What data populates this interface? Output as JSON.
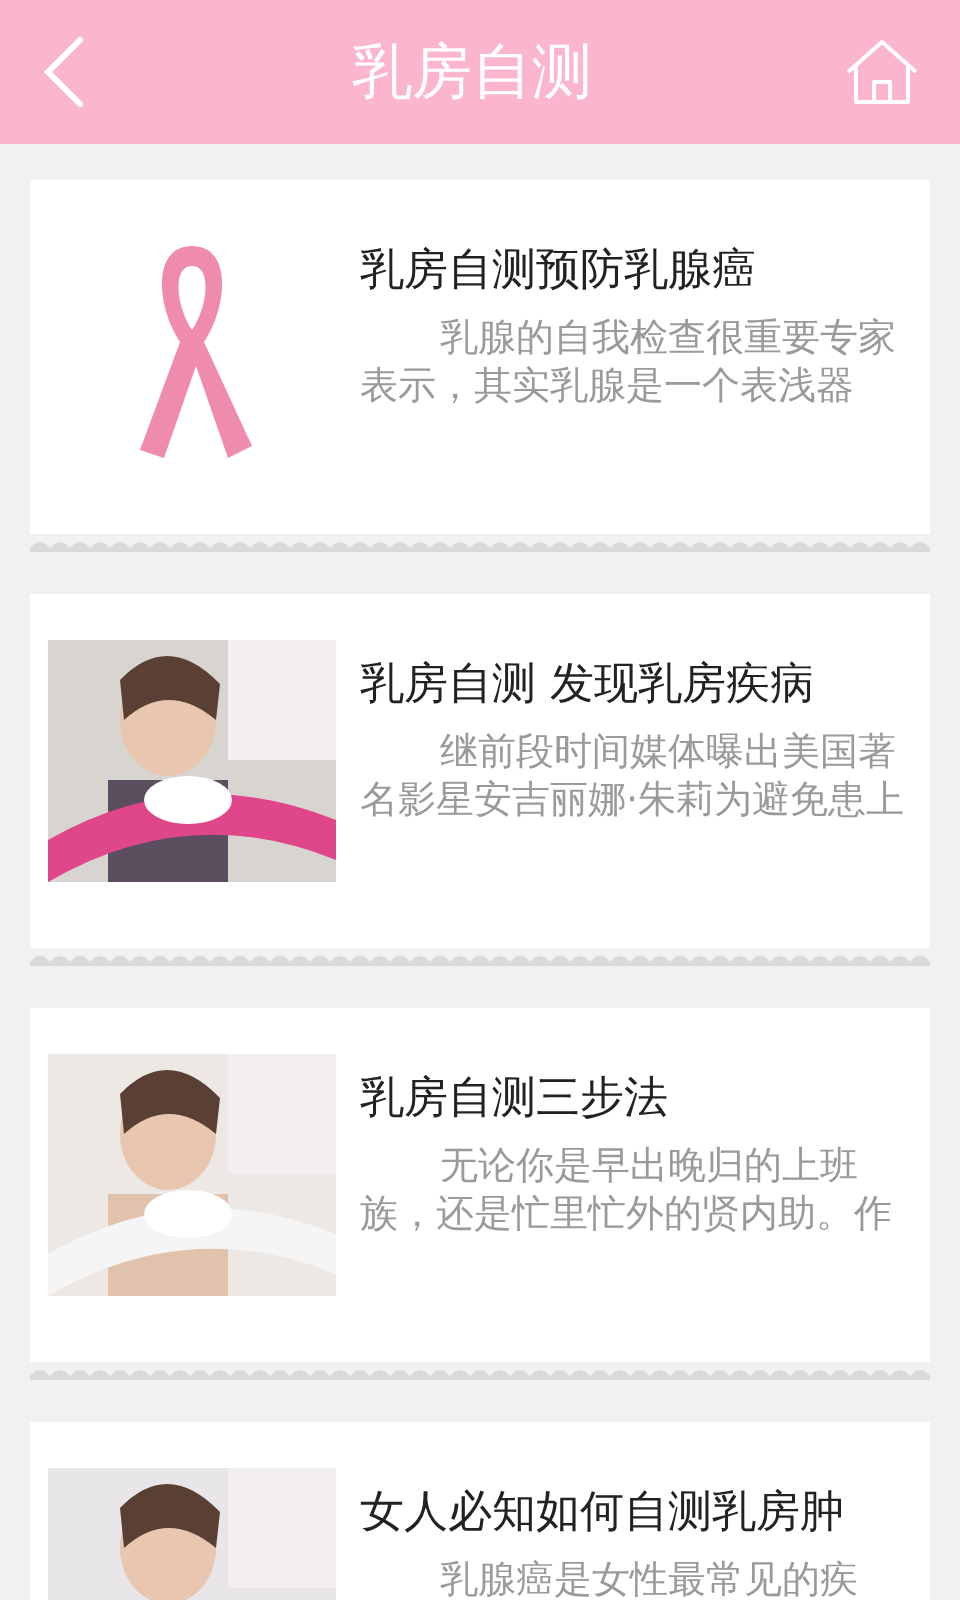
{
  "header": {
    "title": "乳房自测"
  },
  "articles": [
    {
      "title": "乳房自测预防乳腺癌",
      "summary": [
        "乳腺的自我检查很重要专家",
        "表示，其实乳腺是一个表浅器"
      ],
      "image": {
        "kind": "ribbon"
      }
    },
    {
      "title": "乳房自测 发现乳房疾病",
      "summary": [
        "继前段时间媒体曝出美国著",
        "名影星安吉丽娜·朱莉为避免患上"
      ],
      "image": {
        "kind": "picture"
      }
    },
    {
      "title": "乳房自测三步法",
      "summary": [
        "无论你是早出晚归的上班",
        "族，还是忙里忙外的贤内助。作"
      ],
      "image": {
        "kind": "picture"
      }
    },
    {
      "title": "女人必知如何自测乳房肿",
      "summary": [
        "乳腺癌是女性最常见的疾"
      ],
      "image": {
        "kind": "picture"
      }
    }
  ]
}
